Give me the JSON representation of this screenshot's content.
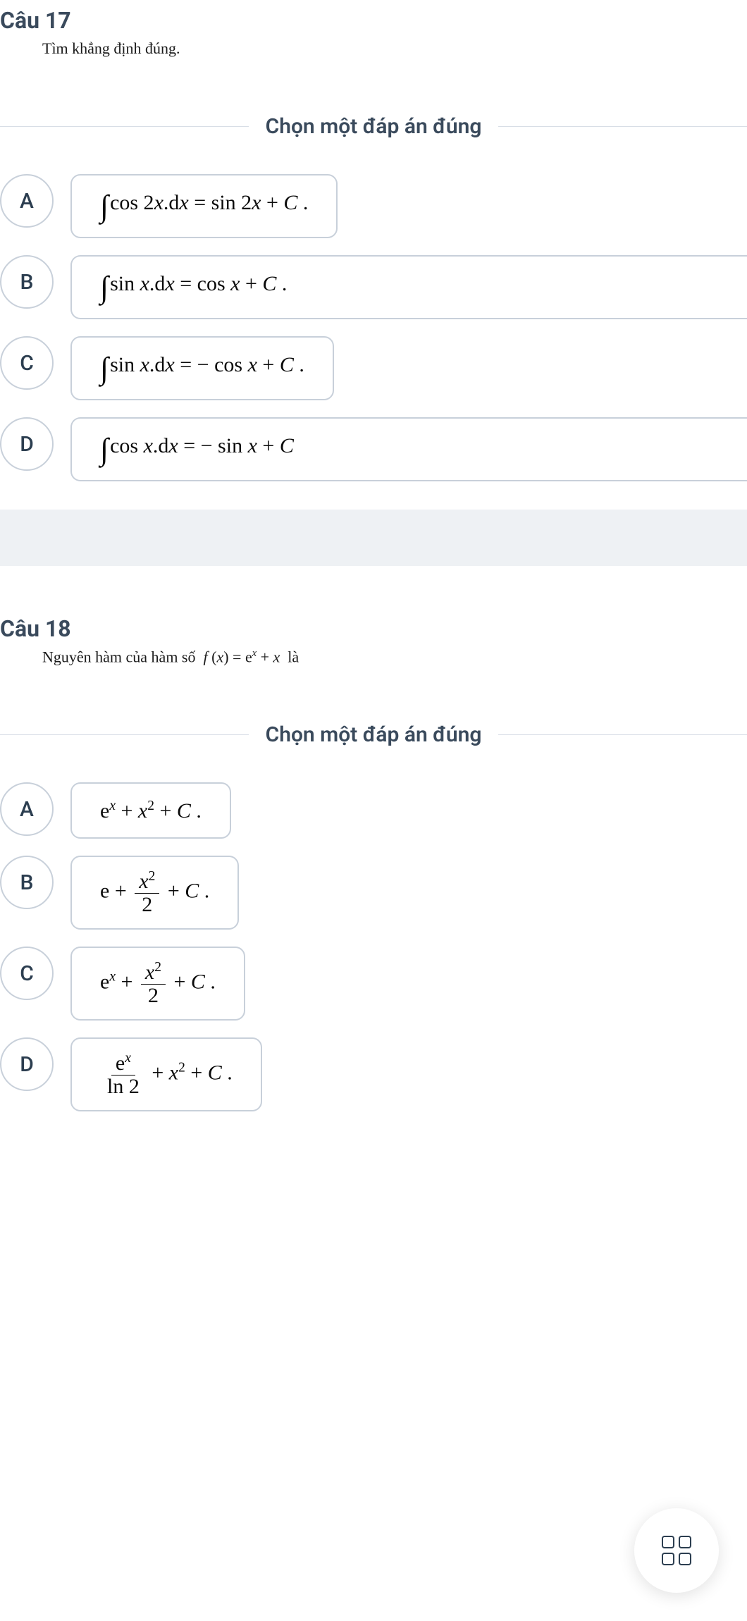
{
  "questions": [
    {
      "title": "Câu 17",
      "prompt_plain": "Tìm khẳng định đúng.",
      "prompt_html": "Tìm khẳng định đúng.",
      "choose_label": "Chọn một đáp án đúng",
      "options": [
        {
          "letter": "A",
          "full": false,
          "math_html": "<span class='intg'>∫</span>cos 2<i>x</i>.d<i>x</i> = sin 2<i>x</i> + <i>C</i> ."
        },
        {
          "letter": "B",
          "full": true,
          "math_html": "<span class='intg'>∫</span>sin <i>x</i>.d<i>x</i> = cos <i>x</i> + <i>C</i> ."
        },
        {
          "letter": "C",
          "full": false,
          "math_html": "<span class='intg'>∫</span>sin <i>x</i>.d<i>x</i> = − cos <i>x</i> + <i>C</i> ."
        },
        {
          "letter": "D",
          "full": true,
          "math_html": "<span class='intg'>∫</span>cos <i>x</i>.d<i>x</i> = − sin <i>x</i> + <i>C</i>"
        }
      ]
    },
    {
      "title": "Câu 18",
      "prompt_plain": "Nguyên hàm của hàm số f(x) = e^x + x là",
      "prompt_html": "Nguyên hàm của hàm số &nbsp;<i>f</i> (<i>x</i>) = e<sup><i>x</i></sup> + <i>x</i>&nbsp; là",
      "choose_label": "Chọn một đáp án đúng",
      "options": [
        {
          "letter": "A",
          "full": false,
          "math_html": "e<sup><i>x</i></sup> + <i>x</i><sup>2</sup> + <i>C</i> ."
        },
        {
          "letter": "B",
          "full": false,
          "math_html": "e + <span class='frac'><span class='num'><i>x</i><sup>2</sup></span><span class='den'>2</span></span> + <i>C</i> ."
        },
        {
          "letter": "C",
          "full": false,
          "math_html": "e<sup><i>x</i></sup> + <span class='frac'><span class='num'><i>x</i><sup>2</sup></span><span class='den'>2</span></span> + <i>C</i> ."
        },
        {
          "letter": "D",
          "full": false,
          "math_html": "<span class='frac'><span class='num'>e<sup><i>x</i></sup></span><span class='den'>ln 2</span></span> + <i>x</i><sup>2</sup> + <i>C</i> ."
        }
      ]
    }
  ],
  "fab_name": "grid-menu"
}
